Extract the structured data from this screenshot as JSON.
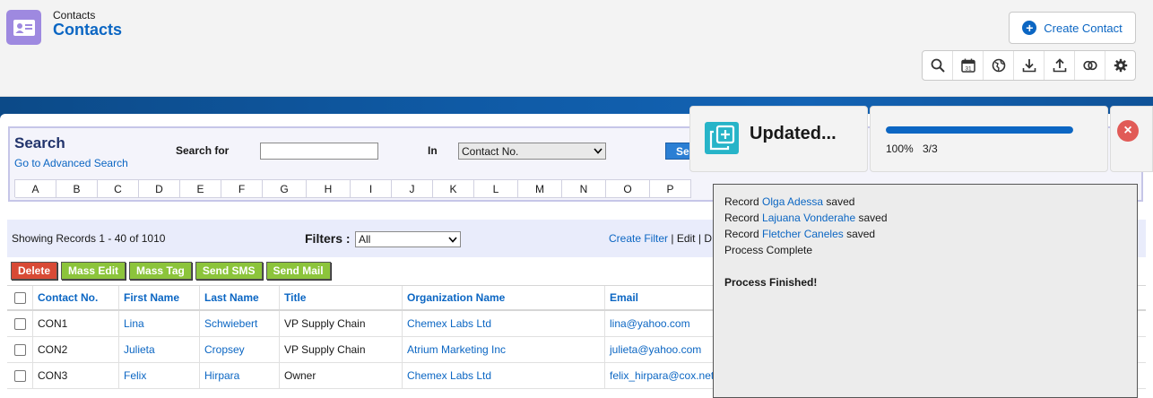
{
  "header": {
    "subtitle": "Contacts",
    "title": "Contacts",
    "create_button": "Create Contact",
    "toolbar_icons": [
      "search-icon",
      "calendar-icon",
      "globe-icon",
      "download-icon",
      "upload-icon",
      "merge-icon",
      "settings-icon"
    ],
    "calendar_day": "31"
  },
  "search": {
    "title": "Search",
    "advanced_link": "Go to Advanced Search",
    "search_for_label": "Search for",
    "search_value": "",
    "in_label": "In",
    "in_selected": "Contact No.",
    "button_label": "Se",
    "alphabet": [
      "A",
      "B",
      "C",
      "D",
      "E",
      "F",
      "G",
      "H",
      "I",
      "J",
      "K",
      "L",
      "M",
      "N",
      "O",
      "P"
    ]
  },
  "list": {
    "showing": "Showing Records 1 - 40 of 1010",
    "filters_label": "Filters :",
    "filter_selected": "All",
    "create_filter": "Create Filter",
    "sep1": " | ",
    "edit": "Edit",
    "sep2": " | ",
    "delete_short": "D"
  },
  "actions": {
    "delete": "Delete",
    "mass_edit": "Mass Edit",
    "mass_tag": "Mass Tag",
    "send_sms": "Send SMS",
    "send_mail": "Send Mail"
  },
  "table": {
    "columns": [
      "Contact No.",
      "First Name",
      "Last Name",
      "Title",
      "Organization Name",
      "Email"
    ],
    "rows": [
      {
        "contact_no": "CON1",
        "first_name": "Lina",
        "last_name": "Schwiebert",
        "title": "VP Supply Chain",
        "organization": "Chemex Labs Ltd",
        "email": "lina@yahoo.com"
      },
      {
        "contact_no": "CON2",
        "first_name": "Julieta",
        "last_name": "Cropsey",
        "title": "VP Supply Chain",
        "organization": "Atrium Marketing Inc",
        "email": "julieta@yahoo.com"
      },
      {
        "contact_no": "CON3",
        "first_name": "Felix",
        "last_name": "Hirpara",
        "title": "Owner",
        "organization": "Chemex Labs Ltd",
        "email": "felix_hirpara@cox.net"
      }
    ]
  },
  "toast": {
    "status": "Updated...",
    "progress_percent": "100%",
    "progress_value": 1.0,
    "progress_count": "3/3",
    "close": "×"
  },
  "log": {
    "lines": [
      {
        "prefix": "Record ",
        "name": "Olga Adessa",
        "suffix": " saved"
      },
      {
        "prefix": "Record ",
        "name": "Lajuana Vonderahe",
        "suffix": " saved"
      },
      {
        "prefix": "Record ",
        "name": "Fletcher Caneles",
        "suffix": " saved"
      }
    ],
    "complete": "Process Complete",
    "finished": "Process Finished!"
  },
  "colors": {
    "accent": "#0b66c3",
    "app_icon": "#9e89e0",
    "delete": "#d84a35",
    "action_green": "#8cc43b",
    "close": "#e15b57"
  }
}
